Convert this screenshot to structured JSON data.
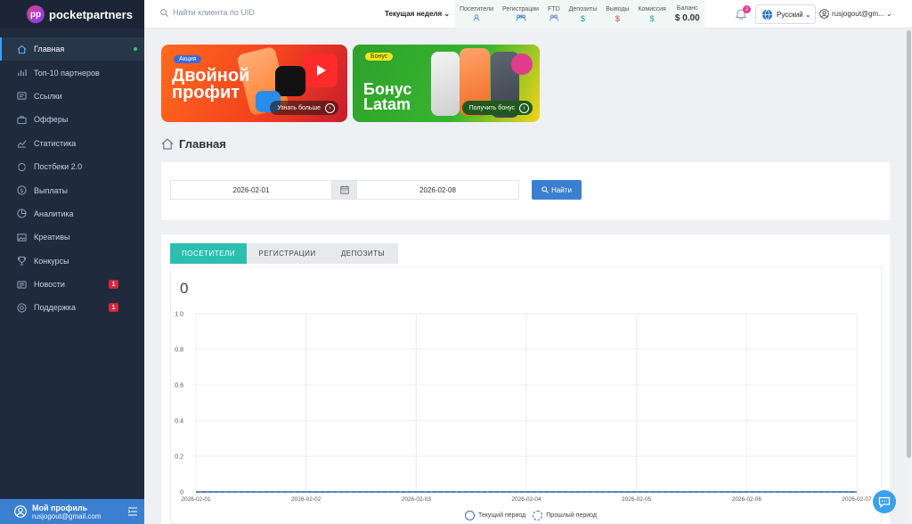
{
  "brand": {
    "name": "pocketpartners"
  },
  "sidebar": {
    "items": [
      {
        "label": "Главная",
        "icon": "home-icon",
        "active": true
      },
      {
        "label": "Топ-10 партнеров",
        "icon": "chart-bars-icon"
      },
      {
        "label": "Ссылки",
        "icon": "link-icon"
      },
      {
        "label": "Офферы",
        "icon": "briefcase-icon"
      },
      {
        "label": "Статистика",
        "icon": "trend-icon"
      },
      {
        "label": "Постбеки 2.0",
        "icon": "postback-icon"
      },
      {
        "label": "Выплаты",
        "icon": "dollar-icon"
      },
      {
        "label": "Аналитика",
        "icon": "analytics-icon"
      },
      {
        "label": "Креативы",
        "icon": "image-icon"
      },
      {
        "label": "Конкурсы",
        "icon": "trophy-icon"
      },
      {
        "label": "Новости",
        "icon": "news-icon",
        "badge": "1"
      },
      {
        "label": "Поддержка",
        "icon": "support-icon",
        "badge": "1"
      }
    ],
    "profile": {
      "title": "Мой профиль",
      "email": "rusjogout@gmail.com"
    }
  },
  "topbar": {
    "search_placeholder": "Найти клиента по UID",
    "period": "Текущая неделя",
    "stats": {
      "visitors": "Посетители",
      "registrations": "Регистрации",
      "ftd": "FTD",
      "deposits": "Депозиты",
      "withdrawals": "Выводы",
      "commission": "Комиссия",
      "balance_label": "Баланс",
      "balance_value": "$ 0.00"
    },
    "notifications_count": "2",
    "language": "Русский",
    "user": "rusjogout@gm..."
  },
  "promos": [
    {
      "tag": "Акция",
      "title": "Двойной профит",
      "button": "Узнать больше"
    },
    {
      "tag": "Бонус",
      "title": "Бонус Latam",
      "button": "Получить бонус"
    }
  ],
  "page": {
    "title": "Главная"
  },
  "filter": {
    "date_from": "2026-02-01",
    "date_to": "2026-02-08",
    "search_button": "Найти"
  },
  "tabs": [
    "ПОСЕТИТЕЛИ",
    "РЕГИСТРАЦИИ",
    "ДЕПОЗИТЫ"
  ],
  "chart_data": {
    "type": "line",
    "total": "0",
    "x": [
      "2026-02-01",
      "2026-02-02",
      "2026-02-03",
      "2026-02-04",
      "2026-02-05",
      "2026-02-06",
      "2026-02-07"
    ],
    "yticks": [
      "0",
      "0.2",
      "0.4",
      "0.6",
      "0.8",
      "1.0"
    ],
    "ylim": [
      0,
      1
    ],
    "series": [
      {
        "name": "Текущий период",
        "values": [
          0,
          0,
          0,
          0,
          0,
          0,
          0
        ]
      },
      {
        "name": "Прошлый период",
        "values": [
          0,
          0,
          0,
          0,
          0,
          0,
          0
        ]
      }
    ],
    "grid": true,
    "legend": "bottom",
    "line_color": "#3b6fb8"
  }
}
